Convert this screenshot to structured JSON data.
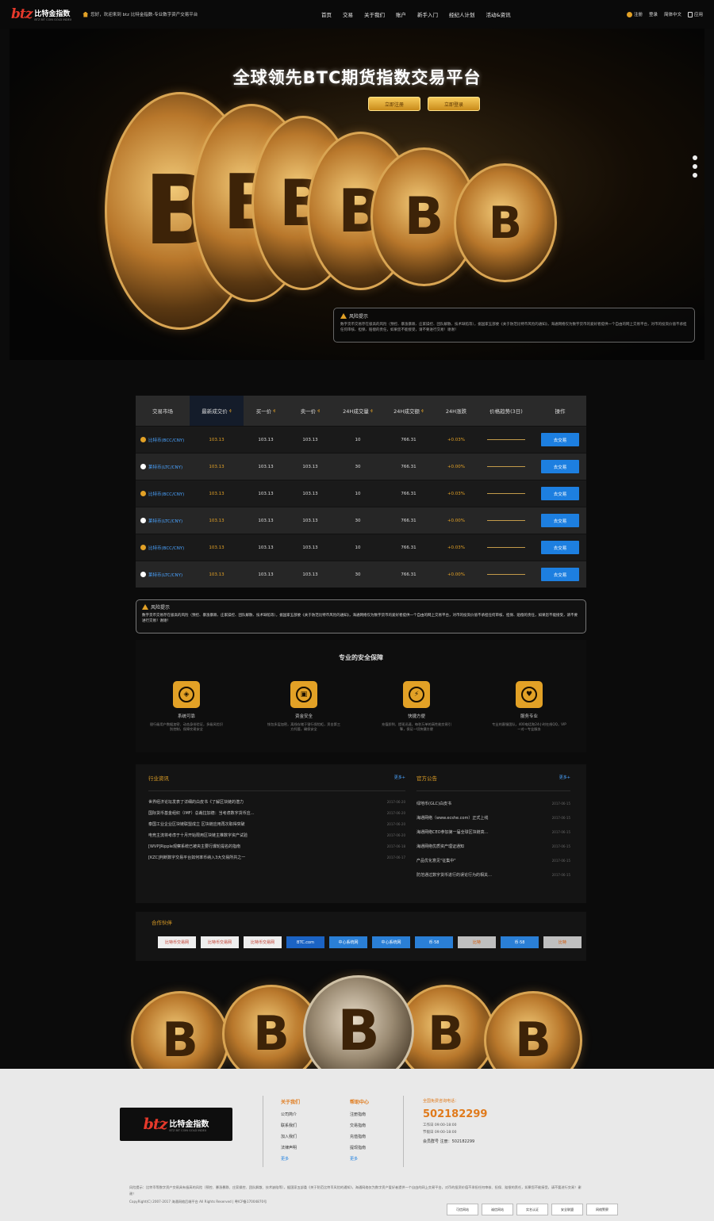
{
  "brand": {
    "mark": "btz",
    "name": "比特金指数",
    "sub": "BTZ BIT COIN GOLD INDEX"
  },
  "topbar": {
    "welcome": "您好，欢迎来到 btz 比特金指数-专业数字资产交易平台",
    "nav": [
      "首页",
      "交易",
      "关于我们",
      "账户",
      "新手入门",
      "经纪人计划",
      "活动&资讯"
    ],
    "register": "注册",
    "login": "登录",
    "language": "简体中文",
    "app": "应用"
  },
  "hero": {
    "title": "全球领先BTC期货指数交易平台",
    "btn_register": "立即注册",
    "btn_login": "立即登录",
    "risk_title": "风险提示",
    "risk_text": "数字货币交易存在极高的风险（预控、暴涨暴跌、庄家操控、团队解散、技术缺陷等），据国家五部委《关于防范比特币风险的通知》，海通网络仅为数字货币的爱好者提供一个自由的网上交易平台，对币的投资价值不承担任何审核、担保、赔偿的责任，如果您不能接受，请不要进行交易！谢谢！"
  },
  "market": {
    "headers": [
      "交易市场",
      "最新成交价",
      "买一价",
      "卖一价",
      "24H成交量",
      "24H成交额",
      "24H涨跌",
      "价格趋势(3日)",
      "操作"
    ],
    "rows": [
      {
        "name": "比特币(BCC/CNY)",
        "last": "103.13",
        "bid": "103.13",
        "ask": "103.13",
        "vol": "10",
        "amt": "766.31",
        "chg": "+0.03%",
        "btn": "去交易",
        "dot": "#e2a126"
      },
      {
        "name": "莱特币(LTC/CNY)",
        "last": "103.13",
        "bid": "103.13",
        "ask": "103.13",
        "vol": "30",
        "amt": "766.31",
        "chg": "+0.00%",
        "btn": "去交易",
        "dot": "#ffffff"
      },
      {
        "name": "比特币(BCC/CNY)",
        "last": "103.13",
        "bid": "103.13",
        "ask": "103.13",
        "vol": "10",
        "amt": "766.31",
        "chg": "+0.03%",
        "btn": "去交易",
        "dot": "#e2a126"
      },
      {
        "name": "莱特币(LTC/CNY)",
        "last": "103.13",
        "bid": "103.13",
        "ask": "103.13",
        "vol": "30",
        "amt": "766.31",
        "chg": "+0.00%",
        "btn": "去交易",
        "dot": "#ffffff"
      },
      {
        "name": "比特币(BCC/CNY)",
        "last": "103.13",
        "bid": "103.13",
        "ask": "103.13",
        "vol": "10",
        "amt": "766.31",
        "chg": "+0.03%",
        "btn": "去交易",
        "dot": "#e2a126"
      },
      {
        "name": "莱特币(LTC/CNY)",
        "last": "103.13",
        "bid": "103.13",
        "ask": "103.13",
        "vol": "30",
        "amt": "766.31",
        "chg": "+0.00%",
        "btn": "去交易",
        "dot": "#ffffff"
      }
    ]
  },
  "risk2": {
    "title": "风险提示",
    "text": "数字货币交易存在极高的风险（预控、暴涨暴跌、庄家操控、团队解散、技术缺陷等），据国家五部委《关于防范比特币风险的通知》，海通网络仅为数字货币的爱好者提供一个自由的网上交易平台，对币的投资价值不承担任何审核、担保、赔偿的责任，如果您不能接受，请不要进行交易！谢谢！"
  },
  "security": {
    "title": "专业的安全保障",
    "features": [
      {
        "name": "系统可靠",
        "desc": "银行级用户数据加密、动态身份验证，多级风险识别控制，保障交易安全",
        "icon": "shield-icon",
        "glyph": "◈"
      },
      {
        "name": "资金安全",
        "desc": "钱包多层加密，离线存储于银行保险柜，资金第三方托管，确保安全",
        "icon": "lock-icon",
        "glyph": "▣"
      },
      {
        "name": "快捷方便",
        "desc": "充值即到、提现迅速，每秒万单的高性能交易引擎，保证一切快捷方便",
        "icon": "lightning-icon",
        "glyph": "⚡"
      },
      {
        "name": "服务专业",
        "desc": "专业的客服团队，400电话和24小时在线QQ，VIP一对一专业服务",
        "icon": "heart-icon",
        "glyph": "♥"
      }
    ]
  },
  "news": {
    "industry_title": "行业资讯",
    "industry_more": "更多+",
    "industry": [
      {
        "title": "世界经济论坛发表了详细的白皮书《了解区块链的潜力",
        "date": "2017-06-20"
      },
      {
        "title": "国际货币基金组织（IMF）总裁拉加德：当考虑数字货币应…",
        "date": "2017-06-20"
      },
      {
        "title": "泰国工业企业区块链联盟成立 区块链应用再次取得突破",
        "date": "2017-06-20"
      },
      {
        "title": "电竞主流将考虑于十月开始限用区块链主推数字资产试验",
        "date": "2017-06-20"
      },
      {
        "title": "[WVP]Ripple观察系统已被央主要行爆轮提名的指南",
        "date": "2017-06-18"
      },
      {
        "title": "[KZC]判断数字交易平台如何率币纳入3大交易所共之一",
        "date": "2017-06-17"
      }
    ],
    "notice_title": "官方公告",
    "notice_more": "更多+",
    "notice": [
      {
        "title": "绿地币(GLC)白皮书",
        "date": "2017-06-15"
      },
      {
        "title": "海通网络（www.ecshe.com）正式上线",
        "date": "2017-06-15"
      },
      {
        "title": "海通网络CEO参加第一届全球区块链高…",
        "date": "2017-06-15"
      },
      {
        "title": "海通网络优质资产理证通知",
        "date": "2017-06-15"
      },
      {
        "title": "产品优化意见\"征集中\"",
        "date": "2017-06-15"
      },
      {
        "title": "防范通过数字货币进行的误论行为的相关…",
        "date": "2017-06-15"
      }
    ]
  },
  "partners": {
    "title": "合作伙伴",
    "items": [
      {
        "label": "比特币交易网",
        "style": "white"
      },
      {
        "label": "比特币交易网",
        "style": "white"
      },
      {
        "label": "比特币交易网",
        "style": "white"
      },
      {
        "label": "BTC.com",
        "style": "blue"
      },
      {
        "label": "中心系统网",
        "style": "tblue"
      },
      {
        "label": "中心系统网",
        "style": "tblue"
      },
      {
        "label": "币·58",
        "style": "tblue"
      },
      {
        "label": "比特",
        "style": "grey"
      },
      {
        "label": "币·58",
        "style": "tblue"
      },
      {
        "label": "比特",
        "style": "grey"
      }
    ]
  },
  "footer": {
    "about_head": "关于我们",
    "about": [
      "公司简介",
      "联系我们",
      "加入我们",
      "法律声明",
      "更多"
    ],
    "help_head": "帮助中心",
    "help": [
      "注册指南",
      "交易指南",
      "充值指南",
      "提现指南",
      "更多"
    ],
    "contact_head": "全国免费咨询电话：",
    "phone": "502182299",
    "hours1": "工作日 09:00-18:00",
    "hours2": "节假日 09:00-18:00",
    "qq": "会员群号 注册：502182299",
    "disclaimer": "风险提示：比特币等数字资产交易具有极高的风险（预控、暴涨暴跌、庄家操控、团队解散、技术缺陷等），据国家五部委《关于防范比特币风险的通知》，海通网络仅为数字资产爱好者提供一个自由的网上交易平台，对币的投资价值不承担任何审核、担保、赔偿的责任，如果您不能接受，请不要进行交易！谢谢！",
    "copyright": "CopyRight(C) 2007-2017 海通网络后端平台 All Rights Reserved  |  粤ICP备17004870号",
    "badges": [
      "可信网站",
      "诚信网站",
      "实名认证",
      "安全联盟",
      "网络警察"
    ]
  }
}
